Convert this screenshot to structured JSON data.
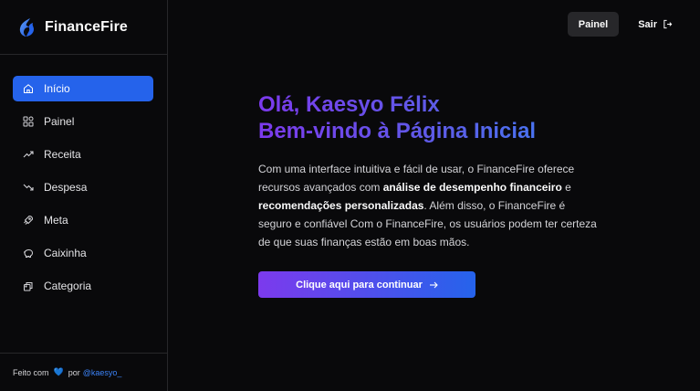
{
  "app": {
    "name": "FinanceFire"
  },
  "sidebar": {
    "items": [
      {
        "label": "Início",
        "icon": "home-icon",
        "active": true
      },
      {
        "label": "Painel",
        "icon": "grid-icon",
        "active": false
      },
      {
        "label": "Receita",
        "icon": "trending-up-icon",
        "active": false
      },
      {
        "label": "Despesa",
        "icon": "trending-down-icon",
        "active": false
      },
      {
        "label": "Meta",
        "icon": "rocket-icon",
        "active": false
      },
      {
        "label": "Caixinha",
        "icon": "piggy-bank-icon",
        "active": false
      },
      {
        "label": "Categoria",
        "icon": "tags-icon",
        "active": false
      }
    ]
  },
  "footer": {
    "made_with": "Feito com",
    "heart": "💙",
    "by": "por",
    "handle": "@kaesyo_"
  },
  "topbar": {
    "panel_label": "Painel",
    "exit_label": "Sair"
  },
  "hero": {
    "greeting_line1": "Olá, Kaesyo Félix",
    "greeting_line2": "Bem-vindo à Página Inicial",
    "desc_part1": "Com uma interface intuitiva e fácil de usar, o FinanceFire oferece recursos avançados com ",
    "desc_bold1": "análise de desempenho financeiro",
    "desc_part2": " e ",
    "desc_bold2": "recomendações personalizadas",
    "desc_part3": ". Além disso, o FinanceFire é seguro e confiável Com o FinanceFire, os usuários podem ter certeza de que suas finanças estão em boas mãos.",
    "cta_label": "Clique aqui para continuar"
  },
  "colors": {
    "accent": "#2563eb",
    "gradient_start": "#7c3aed",
    "background": "#09090b"
  }
}
